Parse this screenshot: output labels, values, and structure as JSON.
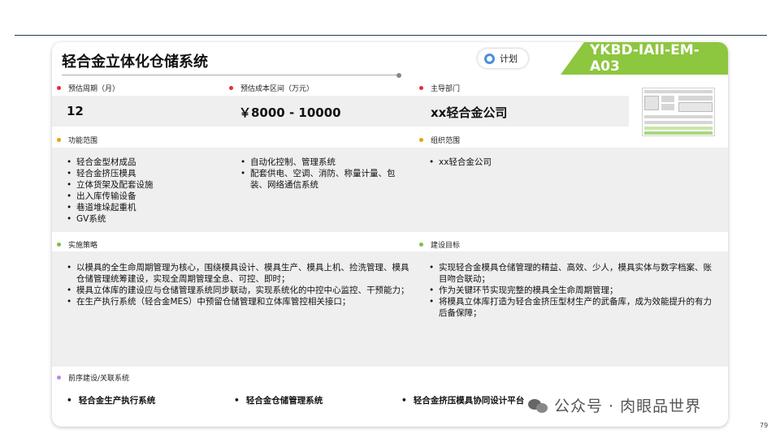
{
  "title": "轻合金立体化仓储系统",
  "status_pill": {
    "label": "计划"
  },
  "code": "YKBD-IAII-EM-A03",
  "colors": {
    "banner": "#8dc63f",
    "pill_icon": "#4a90d9",
    "dot_red": "#e0303a",
    "dot_orange": "#f39c12",
    "dot_green": "#7cc242",
    "dot_purple": "#b78be0"
  },
  "period": {
    "label": "预估周期（月）",
    "value": "12"
  },
  "cost": {
    "label": "预估成本区间（万元）",
    "value": "￥8000 - 10000"
  },
  "department": {
    "label": "主导部门",
    "value": "xx轻合金公司"
  },
  "function_scope": {
    "label": "功能范围",
    "col1": [
      "轻合金型材成品",
      "轻合金挤压模具",
      "立体货架及配套设施",
      "出入库传输设备",
      "巷道堆垛起重机",
      "GV系统"
    ],
    "col2": [
      "自动化控制、管理系统",
      "配套供电、空调、消防、称量计量、包装、网络通信系统"
    ]
  },
  "org_scope": {
    "label": "组织范围",
    "items": [
      "xx轻合金公司"
    ]
  },
  "strategy": {
    "label": "实施策略",
    "items": [
      "以模具的全生命周期管理为核心，围绕模具设计、模具生产、模具上机、捡洗管理、模具仓储管理统筹建设，实现全周期管理全息、可控、即时；",
      "模具立体库的建设应与仓储管理系统同步联动，实现系统化的中控中心监控、干预能力；",
      "在生产执行系统（轻合金MES）中预留仓储管理和立体库管控相关接口；"
    ]
  },
  "goals": {
    "label": "建设目标",
    "items": [
      "实现轻合金模具仓储管理的精益、高效、少人，模具实体与数字档案、账目吻合联动；",
      "作为关键环节实现完整的模具全生命周期管理；",
      "将模具立体库打造为轻合金挤压型材生产的武备库，成为效能提升的有力后备保障；"
    ]
  },
  "related": {
    "label": "前序建设/关联系统",
    "items": [
      "轻合金生产执行系统",
      "轻合金仓储管理系统",
      "轻合金挤压模具协同设计平台"
    ]
  },
  "watermark": "公众号 · 肉眼品世界",
  "page_number": "79",
  "icons": {
    "pill": "ring-icon",
    "watermark": "wechat-icon"
  }
}
